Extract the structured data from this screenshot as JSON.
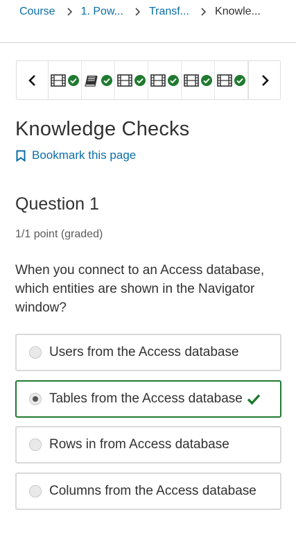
{
  "breadcrumb": {
    "items": [
      "Course",
      "1. Pow...",
      "Transf...",
      "Knowle..."
    ]
  },
  "sequence_nav": {
    "units": [
      {
        "icon": "video-icon",
        "complete": true
      },
      {
        "icon": "book-icon",
        "complete": true
      },
      {
        "icon": "video-icon",
        "complete": true
      },
      {
        "icon": "video-icon",
        "complete": true
      },
      {
        "icon": "video-icon",
        "complete": true
      },
      {
        "icon": "video-icon",
        "complete": true
      }
    ]
  },
  "page": {
    "title": "Knowledge Checks",
    "bookmark_label": "Bookmark this page"
  },
  "question": {
    "title": "Question 1",
    "points": "1/1 point (graded)",
    "prompt": "When you connect to an Access database, which entities are shown in the Navigator window?",
    "choices": [
      {
        "label": "Users from the Access database",
        "selected": false,
        "correct": false
      },
      {
        "label": "Tables from the Access database",
        "selected": true,
        "correct": true
      },
      {
        "label": "Rows in from Access database",
        "selected": false,
        "correct": false
      },
      {
        "label": "Columns from the Access database",
        "selected": false,
        "correct": false
      }
    ]
  },
  "colors": {
    "link": "#0a6ea8",
    "success": "#1f7a2f",
    "border": "#d9d9d9"
  }
}
